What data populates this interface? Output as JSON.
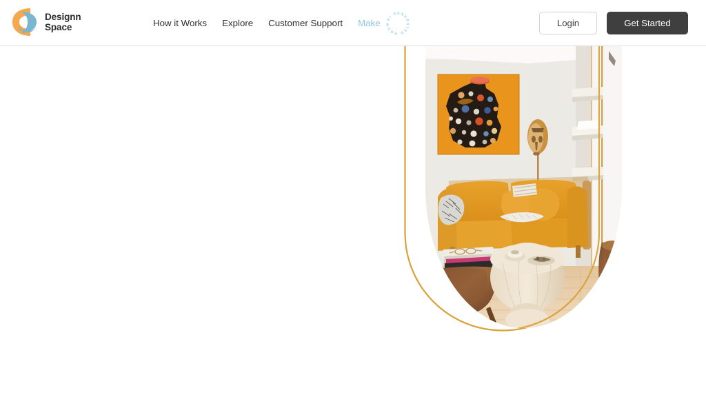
{
  "header": {
    "brand": {
      "line1": "Designn",
      "line2": "Space",
      "logo_icon": "designn-space-logo-icon",
      "colors": {
        "orange": "#f5a94f",
        "blue": "#79b6cf"
      }
    },
    "nav": [
      {
        "label": "How it Works",
        "name": "nav-how-it-works"
      },
      {
        "label": "Explore",
        "name": "nav-explore"
      },
      {
        "label": "Customer Support",
        "name": "nav-customer-support"
      }
    ],
    "make": {
      "label": "Make",
      "color": "#8fc6e3",
      "badge_text": "AI GENERATED ROOMS",
      "badge_icon": "ai-generated-rooms-circular-badge-icon"
    },
    "actions": {
      "login_label": "Login",
      "get_started_label": "Get Started",
      "get_started_bg": "#3f3f3f"
    }
  },
  "hero": {
    "photo": {
      "alt": "AI generated living room with mustard velvet sofa, abstract artwork, wooden side tables and floating shelves",
      "accent_outline_color": "#d9a23a",
      "shape": "arch-rounded-bottom"
    }
  }
}
